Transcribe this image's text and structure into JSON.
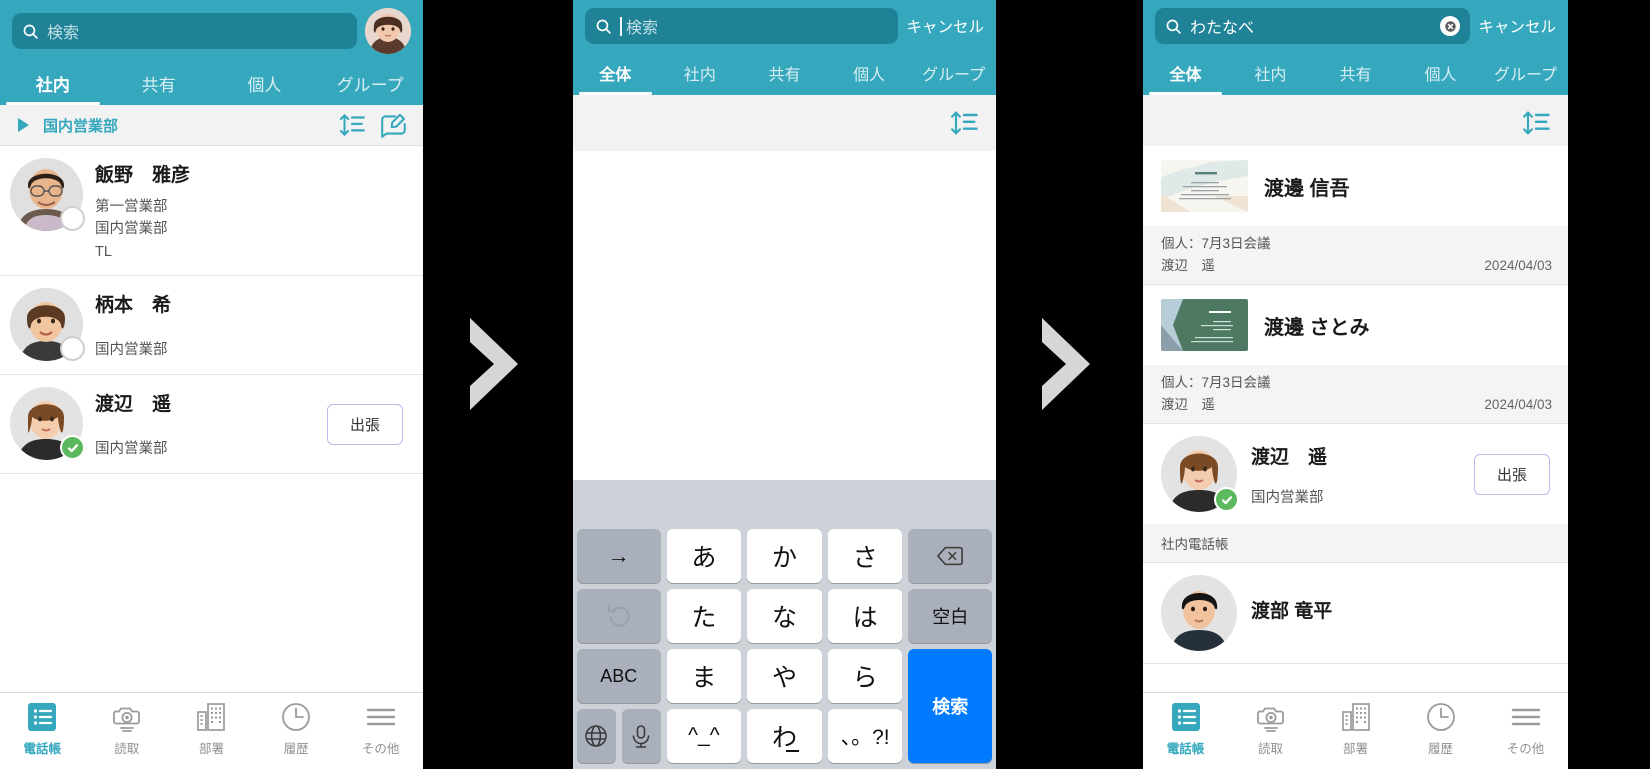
{
  "app": {
    "accent": "#35a8bd",
    "search_bg": "#1f8296",
    "badge_green": "#5cb85c",
    "key_blue": "#007aff"
  },
  "panel1": {
    "search": {
      "placeholder": "検索",
      "value": "",
      "icon": "search-icon"
    },
    "avatar_name": "user-avatar",
    "tabs": [
      {
        "label": "社内",
        "active": true
      },
      {
        "label": "共有",
        "active": false
      },
      {
        "label": "個人",
        "active": false
      },
      {
        "label": "グループ",
        "active": false
      }
    ],
    "group": {
      "name": "国内営業部",
      "sort_icon": "sort-icon",
      "compose_icon": "compose-icon"
    },
    "contacts": [
      {
        "name": "飯野　雅彦",
        "lines": [
          "第一営業部",
          "国内営業部",
          "TL"
        ],
        "status": "",
        "presence": "ring"
      },
      {
        "name": "柄本　希",
        "lines": [
          "国内営業部"
        ],
        "status": "",
        "presence": "ring"
      },
      {
        "name": "渡辺　遥",
        "lines": [
          "国内営業部"
        ],
        "status": "出張",
        "presence": "check"
      }
    ]
  },
  "panel2": {
    "search": {
      "placeholder": "検索",
      "value": "",
      "icon": "search-icon"
    },
    "cancel_label": "キャンセル",
    "tabs": [
      {
        "label": "全体",
        "active": true
      },
      {
        "label": "社内",
        "active": false
      },
      {
        "label": "共有",
        "active": false
      },
      {
        "label": "個人",
        "active": false
      },
      {
        "label": "グループ",
        "active": false
      }
    ],
    "sort_icon": "sort-icon",
    "keyboard": {
      "rows": [
        [
          {
            "label": "→",
            "type": "fn",
            "name": "cursor-right-key"
          },
          {
            "label": "あ",
            "type": "kana",
            "name": "key-a"
          },
          {
            "label": "か",
            "type": "kana",
            "name": "key-ka"
          },
          {
            "label": "さ",
            "type": "kana",
            "name": "key-sa"
          },
          {
            "label": "",
            "type": "fn",
            "icon": "backspace-icon",
            "name": "backspace-key"
          }
        ],
        [
          {
            "label": "",
            "type": "fn",
            "icon": "undo-icon",
            "name": "undo-key"
          },
          {
            "label": "た",
            "type": "kana",
            "name": "key-ta"
          },
          {
            "label": "な",
            "type": "kana",
            "name": "key-na"
          },
          {
            "label": "は",
            "type": "kana",
            "name": "key-ha"
          },
          {
            "label": "空白",
            "type": "fn",
            "name": "space-key"
          }
        ],
        [
          {
            "label": "ABC",
            "type": "fn",
            "name": "abc-key"
          },
          {
            "label": "ま",
            "type": "kana",
            "name": "key-ma"
          },
          {
            "label": "や",
            "type": "kana",
            "name": "key-ya"
          },
          {
            "label": "ら",
            "type": "kana",
            "name": "key-ra"
          },
          {
            "label": "検索",
            "type": "blue",
            "name": "search-key"
          }
        ],
        [
          {
            "label": "",
            "type": "split",
            "icon": "globe-icon",
            "icon2": "mic-icon",
            "name": "globe-mic-keys"
          },
          {
            "label": "^_^",
            "type": "kana",
            "name": "key-emoji"
          },
          {
            "label": "わ",
            "type": "kana",
            "name": "key-wa"
          },
          {
            "label": "、。?!",
            "type": "kana",
            "name": "key-punct"
          }
        ]
      ]
    }
  },
  "panel3": {
    "search": {
      "placeholder": "検索",
      "value": "わたなべ",
      "icon": "search-icon",
      "clear_icon": "clear-icon"
    },
    "cancel_label": "キャンセル",
    "tabs": [
      {
        "label": "全体",
        "active": true
      },
      {
        "label": "社内",
        "active": false
      },
      {
        "label": "共有",
        "active": false
      },
      {
        "label": "個人",
        "active": false
      },
      {
        "label": "グループ",
        "active": false
      }
    ],
    "sort_icon": "sort-icon",
    "results": [
      {
        "kind": "card",
        "name": "渡邊 信吾",
        "meta_label": "個人：7月3日会議",
        "meta_owner": "渡辺　遥",
        "date": "2024/04/03",
        "card_style": "beige"
      },
      {
        "kind": "card",
        "name": "渡邊 さとみ",
        "meta_label": "個人：7月3日会議",
        "meta_owner": "渡辺　遥",
        "date": "2024/04/03",
        "card_style": "green"
      },
      {
        "kind": "person",
        "name": "渡辺　遥",
        "dept": "国内営業部",
        "status": "出張",
        "footer": "社内電話帳",
        "presence": "check"
      },
      {
        "kind": "person",
        "name": "渡部 竜平",
        "dept": "",
        "status": "",
        "footer": "",
        "presence": "none"
      }
    ]
  },
  "bottom_tabs": [
    {
      "label": "電話帳",
      "icon": "phonebook-icon",
      "active": true
    },
    {
      "label": "読取",
      "icon": "camera-icon",
      "active": false
    },
    {
      "label": "部署",
      "icon": "building-icon",
      "active": false
    },
    {
      "label": "履歴",
      "icon": "clock-icon",
      "active": false
    },
    {
      "label": "その他",
      "icon": "menu-icon",
      "active": false
    }
  ]
}
